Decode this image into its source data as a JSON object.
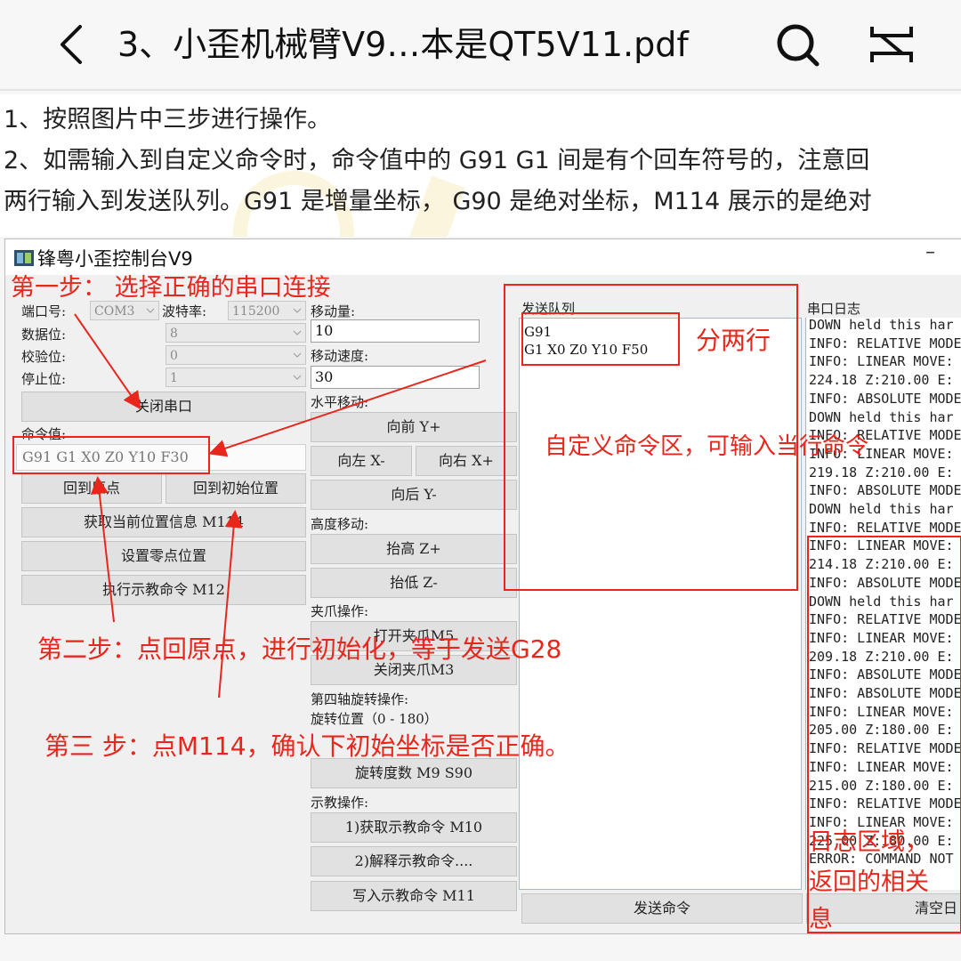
{
  "header": {
    "title": "3、小歪机械臂V9…本是QT5V11.pdf",
    "back_icon": "chevron-left-icon",
    "search_icon": "search-icon",
    "menu_icon": "expand-icon"
  },
  "doc": {
    "line1": "1、按照图片中三步进行操作。",
    "line2": "2、如需输入到自定义命令时，命令值中的 G91 G1 间是有个回车符号的，注意回",
    "line3": "两行输入到发送队列。G91 是增量坐标，  G90 是绝对坐标，M114 展示的是绝对"
  },
  "window": {
    "title": "锋粤小歪控制台V9",
    "minimize": "–",
    "labels": {
      "port": "端口号:",
      "baud": "波特率:",
      "databits": "数据位:",
      "parity": "校验位:",
      "stopbits": "停止位:",
      "command_value": "命令值:",
      "move_amount": "移动量:",
      "move_speed": "移动速度:",
      "horizontal": "水平移动:",
      "height": "高度移动:",
      "gripper": "夹爪操作:",
      "fourth_axis": "第四轴旋转操作:",
      "rotate_pos": "旋转位置（0 - 180）",
      "teach": "示教操作:",
      "queue": "发送队列",
      "log": "串口日志"
    },
    "values": {
      "port": "COM3",
      "baud": "115200",
      "databits": "8",
      "parity": "0",
      "stopbits": "1",
      "command_value": "G91 G1 X0 Z0 Y10 F30",
      "move_amount": "10",
      "move_speed": "30"
    },
    "buttons": {
      "close_port": "关闭串口",
      "home": "回到原点",
      "initial_pos": "回到初始位置",
      "get_pos": "获取当前位置信息 M114",
      "set_zero": "设置零点位置",
      "run_teach": "执行示教命令 M12",
      "forward": "向前 Y+",
      "left": "向左 X-",
      "right": "向右 X+",
      "back": "向后 Y-",
      "raise": "抬高 Z+",
      "lower": "抬低 Z-",
      "open_gripper": "打开夹爪M5",
      "close_gripper": "关闭夹爪M3",
      "rotate": "旋转度数 M9 S90",
      "get_teach": "1)获取示教命令 M10",
      "parse_teach": "2)解释示教命令....",
      "write_teach": "写入示教命令 M11",
      "send": "发送命令",
      "clear": "清空日"
    },
    "queue_lines": [
      "G91",
      "G1 X0 Z0 Y10 F50"
    ],
    "log_lines": [
      "DOWN held this har",
      "INFO: RELATIVE MODE",
      "INFO: LINEAR MOVE:",
      "224.18 Z:210.00 E:",
      "INFO: ABSOLUTE MODE",
      "DOWN held this har",
      "INFO: RELATIVE MODE",
      "INFO: LINEAR MOVE:",
      "219.18 Z:210.00 E:",
      "INFO: ABSOLUTE MODE",
      "DOWN held this har",
      "INFO: RELATIVE MODE",
      "INFO: LINEAR MOVE:",
      "214.18 Z:210.00 E:",
      "INFO: ABSOLUTE MODE",
      "DOWN held this har",
      "INFO: RELATIVE MODE",
      "INFO: LINEAR MOVE:",
      "209.18 Z:210.00 E:",
      "INFO: ABSOLUTE MODE",
      "INFO: ABSOLUTE MODE",
      "INFO: LINEAR MOVE:",
      "205.00 Z:180.00 E:",
      "INFO: RELATIVE MODE",
      "INFO: LINEAR MOVE:",
      "215.00 Z:180.00 E:",
      "INFO: RELATIVE MODE",
      "INFO: LINEAR MOVE:",
      "225.00 Z:180.00 E:",
      "ERROR: COMMAND NOT"
    ]
  },
  "annotations": {
    "step1": "第一步：  选择正确的串口连接",
    "two_lines": "分两行",
    "custom_area": "自定义命令区，可输入当行命令",
    "step2": "第二步：点回原点，进行初始化，等于发送G28",
    "step3": "第三 步：点M114，确认下初始坐标是否正确。",
    "log_area_1": "日志区域，",
    "log_area_2": "返回的相关",
    "log_area_3": "息"
  },
  "colors": {
    "annotation_red": "#e8261c"
  }
}
